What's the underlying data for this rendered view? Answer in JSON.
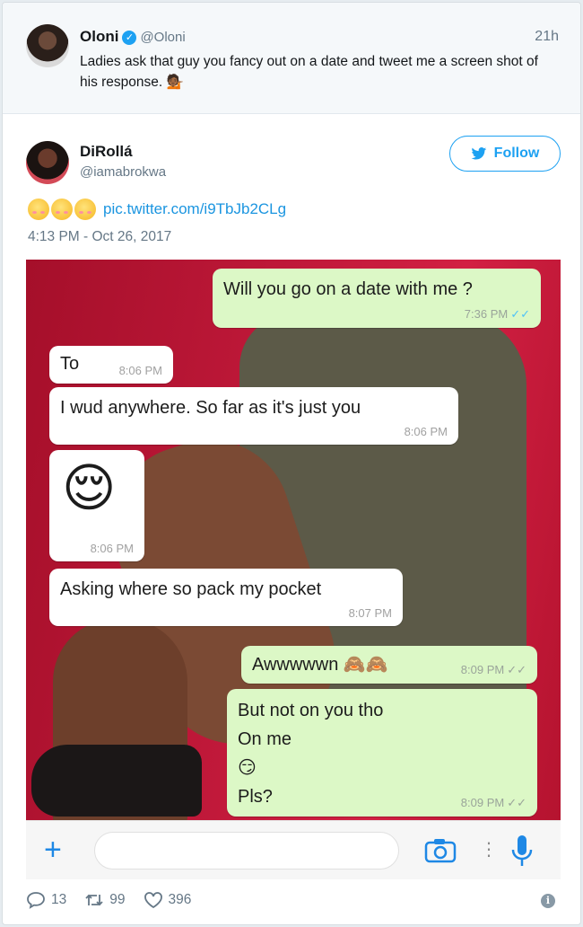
{
  "quoted_tweet": {
    "name": "Oloni",
    "handle": "@Oloni",
    "time": "21h",
    "text": "Ladies ask that guy you fancy out on a date and tweet me a screen shot of his response. 💁🏾",
    "avatar_icon": "avatar-photo"
  },
  "tweet": {
    "name": "DiRollá",
    "handle": "@iamabrokwa",
    "follow_label": "Follow",
    "emojis": "😊😊😊",
    "link": "pic.twitter.com/i9TbJb2CLg",
    "date": "4:13 PM - Oct 26, 2017",
    "avatar_icon": "avatar-photo"
  },
  "chat": {
    "messages": [
      {
        "dir": "out",
        "text": "Will you go on a date with me ?",
        "time": "7:36 PM",
        "ticks": "✓✓",
        "tick_color": "#4fc3f7"
      },
      {
        "dir": "in",
        "text": "To",
        "time": "8:06 PM"
      },
      {
        "dir": "in",
        "text": "I wud anywhere. So far as it's just you",
        "time": "8:06 PM"
      },
      {
        "dir": "in",
        "text": "😌",
        "time": "8:06 PM"
      },
      {
        "dir": "in",
        "text": "Asking where so pack my pocket",
        "time": "8:07 PM"
      },
      {
        "dir": "out",
        "text": "Awwwwwn 🙈🙈",
        "time": "8:09 PM",
        "ticks": "✓✓",
        "tick_color": "#9aa49a"
      },
      {
        "dir": "out",
        "lines": [
          "But not on you tho",
          "On me",
          "😏",
          "Pls?"
        ],
        "time": "8:09 PM",
        "ticks": "✓✓",
        "tick_color": "#9aa49a"
      }
    ],
    "colors": {
      "incoming": "#ffffff",
      "outgoing": "#dcf8c6",
      "backdrop": "#c1193a"
    }
  },
  "composer": {
    "plus_label": "+",
    "more_label": "⋮",
    "icons": [
      "plus-icon",
      "camera-icon",
      "more-icon",
      "microphone-icon"
    ]
  },
  "actions": {
    "replies": "13",
    "retweets": "99",
    "likes": "396",
    "info_label": "i"
  }
}
